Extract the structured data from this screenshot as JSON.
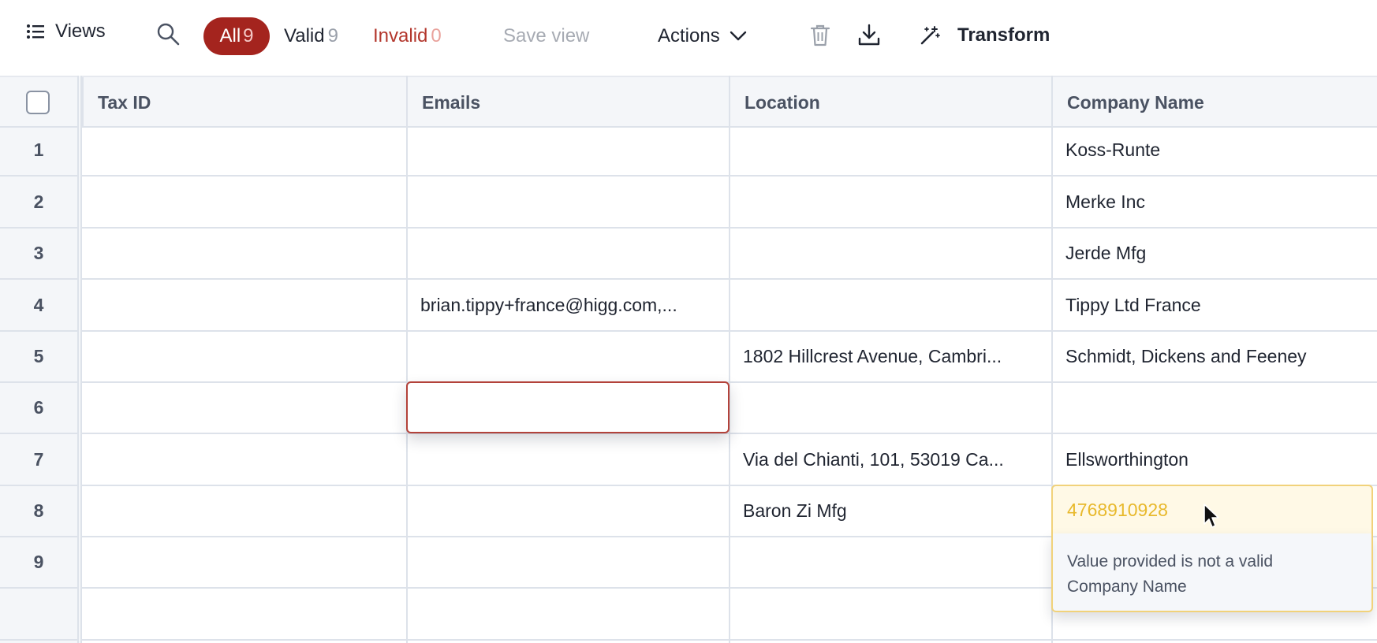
{
  "toolbar": {
    "views_label": "Views",
    "all_label": "All",
    "all_count": "9",
    "valid_label": "Valid",
    "valid_count": "9",
    "invalid_label": "Invalid",
    "invalid_count": "0",
    "save_view_label": "Save view",
    "actions_label": "Actions",
    "transform_label": "Transform"
  },
  "table": {
    "columns": [
      "Tax ID",
      "Emails",
      "Location",
      "Company Name"
    ],
    "rows": [
      {
        "num": "1",
        "tax_id": "",
        "emails": "",
        "location": "",
        "company": "Koss-Runte"
      },
      {
        "num": "2",
        "tax_id": "",
        "emails": "",
        "location": "",
        "company": "Merke Inc"
      },
      {
        "num": "3",
        "tax_id": "",
        "emails": "",
        "location": "",
        "company": "Jerde Mfg"
      },
      {
        "num": "4",
        "tax_id": "",
        "emails": "brian.tippy+france@higg.com,...",
        "location": "",
        "company": "Tippy Ltd France"
      },
      {
        "num": "5",
        "tax_id": "",
        "emails": "",
        "location": "1802 Hillcrest Avenue, Cambri...",
        "company": "Schmidt, Dickens and Feeney"
      },
      {
        "num": "6",
        "tax_id": "",
        "emails": "",
        "location": "",
        "company": ""
      },
      {
        "num": "7",
        "tax_id": "",
        "emails": "",
        "location": "Via del Chianti, 101, 53019 Ca...",
        "company": "Ellsworthington"
      },
      {
        "num": "8",
        "tax_id": "",
        "emails": "",
        "location": "Baron Zi Mfg",
        "company": "4768910928"
      },
      {
        "num": "9",
        "tax_id": "",
        "emails": "",
        "location": "",
        "company": ""
      }
    ]
  },
  "tooltip": {
    "line1": "Value provided is not a valid",
    "line2": "Company Name"
  },
  "colors": {
    "accent": "#a4241e",
    "invalid": "#b3372d",
    "warning": "#e8b92c"
  }
}
